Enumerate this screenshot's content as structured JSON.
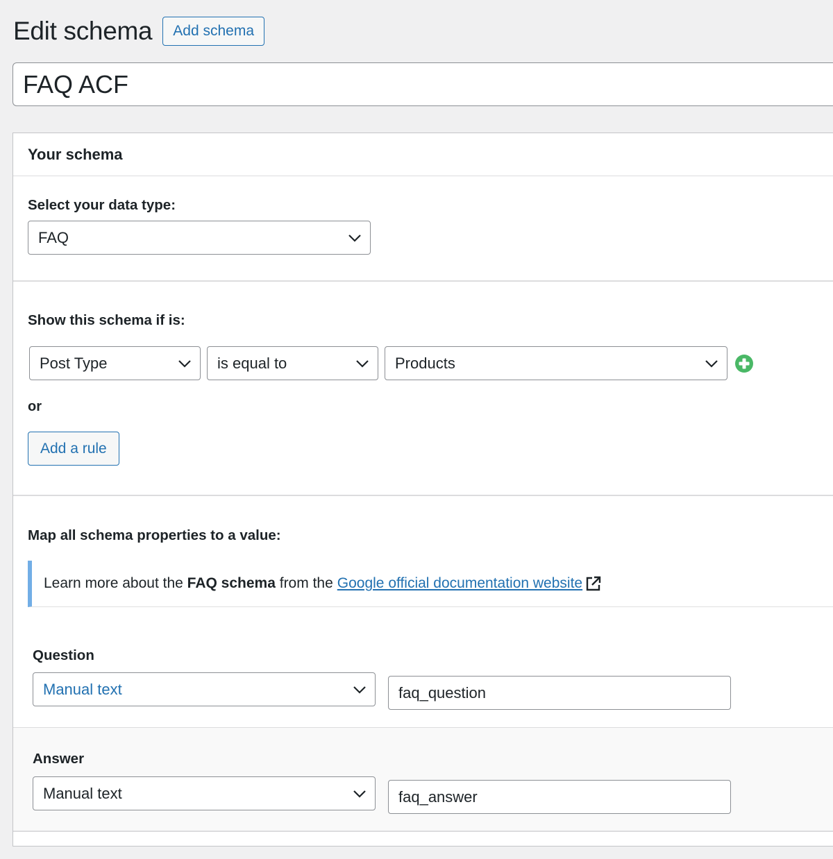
{
  "header": {
    "title": "Edit schema",
    "add_button": "Add schema"
  },
  "title_input": {
    "value": "FAQ ACF"
  },
  "panel": {
    "heading": "Your schema",
    "data_type": {
      "label": "Select your data type:",
      "value": "FAQ"
    },
    "conditions": {
      "label": "Show this schema if is:",
      "rule": {
        "param": "Post Type",
        "operator": "is equal to",
        "value": "Products"
      },
      "or_label": "or",
      "add_rule_button": "Add a rule"
    },
    "mapping": {
      "label": "Map all schema properties to a value:",
      "notice": {
        "prefix": "Learn more about the",
        "bold": "FAQ schema",
        "middle": "from the",
        "link_text": "Google official documentation website"
      },
      "properties": [
        {
          "label": "Question",
          "source": "Manual text",
          "value": "faq_question"
        },
        {
          "label": "Answer",
          "source": "Manual text",
          "value": "faq_answer"
        }
      ]
    }
  },
  "icons": {
    "add_condition": "plus-circle-icon",
    "external_link": "external-link-icon",
    "dropdown": "chevron-down-icon"
  },
  "colors": {
    "accent": "#2271b1",
    "notice_border": "#72aee6",
    "add_green": "#4ab866"
  }
}
